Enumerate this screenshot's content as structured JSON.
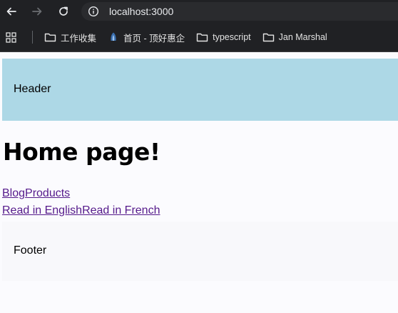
{
  "browser": {
    "url": "localhost:3000",
    "bookmarks": [
      {
        "label": "工作收集",
        "icon": "folder-icon"
      },
      {
        "label": "首页 - 顶好惠企",
        "icon": "site-favicon-icon"
      },
      {
        "label": "typescript",
        "icon": "folder-icon"
      },
      {
        "label": "Jan Marshal",
        "icon": "folder-icon"
      }
    ]
  },
  "page": {
    "header_text": "Header",
    "title": "Home page!",
    "nav_links": [
      "Blog",
      "Products"
    ],
    "lang_links": [
      "Read in English",
      "Read in French"
    ],
    "footer_text": "Footer"
  },
  "colors": {
    "header_bg": "#add8e6",
    "link_visited": "#551a8b",
    "chrome_bg": "#202124"
  }
}
